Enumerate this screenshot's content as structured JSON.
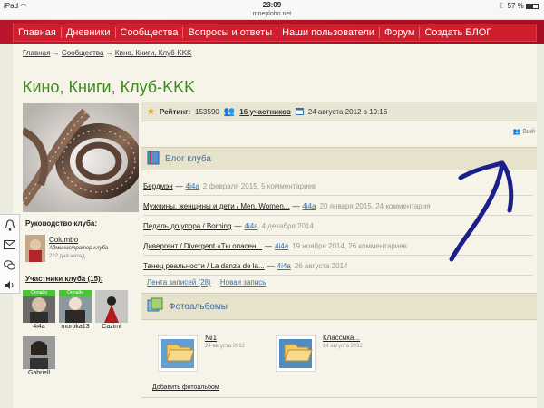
{
  "status": {
    "carrier": "iPad",
    "time": "23:09",
    "url": "mneploho.net",
    "battery": "57 %"
  },
  "nav": [
    "Главная",
    "Дневники",
    "Сообщества",
    "Вопросы и ответы",
    "Наши пользователи",
    "Форум",
    "Создать БЛОГ"
  ],
  "breadcrumb": {
    "home": "Главная",
    "sep1": "→",
    "communities": "Сообщества",
    "sep2": "→",
    "current": "Кино, Книги, Клуб-KKK"
  },
  "title": "Кино, Книги, Клуб-KKK",
  "stats": {
    "rating_label": "Рейтинг:",
    "rating": "153590",
    "members": "16 участников",
    "date": "24 августа 2012 в 19:16"
  },
  "action_label": "Вый",
  "leadership": {
    "heading": "Руководство клуба:",
    "name": "Columbo",
    "role": "Администратор клуба",
    "ago": "222 дня назад"
  },
  "members_heading": "Участники клуба (15):",
  "online_label": "Онлайн",
  "members": [
    {
      "name": "4i4a"
    },
    {
      "name": "moroka13"
    },
    {
      "name": "Cazimi"
    },
    {
      "name": "Gabriell"
    }
  ],
  "blog": {
    "heading": "Блог клуба",
    "posts": [
      {
        "title": "Бердмэн",
        "author": "4i4a",
        "meta": "2 февраля 2015, 5 комментариев"
      },
      {
        "title": "Мужчины, женщины и дети / Men, Women...",
        "author": "4i4a",
        "meta": "20 января 2015, 24 комментария"
      },
      {
        "title": "Педаль до упора / Borning",
        "author": "4i4a",
        "meta": "4 декабря 2014"
      },
      {
        "title": "Дивергент / Divergent «Ты опасен...",
        "author": "4i4a",
        "meta": "19 ноября 2014, 26 комментариев"
      },
      {
        "title": "Танец реальности / La danza de la...",
        "author": "4i4a",
        "meta": "26 августа 2014"
      }
    ],
    "feed_link": "Лента записей (28)",
    "new_post_link": "Новая запись"
  },
  "albums": {
    "heading": "Фотоальбомы",
    "items": [
      {
        "name": "№1",
        "date": "24 августа 2012"
      },
      {
        "name": "Классика...",
        "date": "24 августа 2012"
      }
    ],
    "add_link": "Добавить фотоальбом"
  },
  "colors": {
    "nav_red": "#cf1f2e",
    "title_green": "#3c8c1e",
    "link_blue": "#3d6fa0",
    "annotation_ink": "#1a1f8a"
  }
}
